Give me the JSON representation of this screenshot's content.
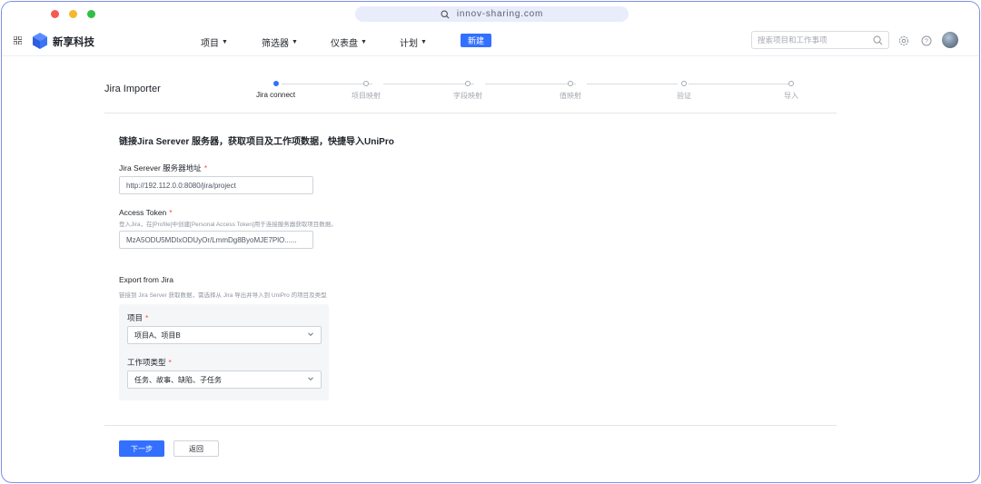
{
  "window": {
    "url": "innov-sharing.com"
  },
  "header": {
    "brand": "新享科技",
    "nav": [
      "项目",
      "筛选器",
      "仪表盘",
      "计划"
    ],
    "new_label": "新建",
    "search_placeholder": "搜索项目和工作事项",
    "accent_color": "#3370ff"
  },
  "page": {
    "title": "Jira Importer",
    "steps": [
      "Jira connect",
      "项目映射",
      "字段映射",
      "值映射",
      "验证",
      "导入"
    ],
    "active_step": 0
  },
  "form": {
    "intro": "链接Jira Serever 服务器，获取项目及工作项数据，快捷导入UniPro",
    "server_label": "Jira Serever 服务器地址",
    "server_value": "http://192.112.0.0:8080/jira/project",
    "token_label": "Access Token",
    "token_hint": "登入Jira，在[Profile]中创建[Personal Access Token]用于连接服务器获取项目数据。",
    "token_value": "MzA5ODU5MDIxODUyOr/LmmDg8ByoMJE7PlO......",
    "required_mark": "*",
    "export_title": "Export from Jira",
    "export_hint": "链接到 Jira Server 获取数据，需选择从 Jira 导出并导入到 UniPro 的项目及类型",
    "project_label": "项目",
    "project_value": "项目A、项目B",
    "type_label": "工作项类型",
    "type_value": "任务、故事、缺陷、子任务"
  },
  "footer": {
    "next_label": "下一步",
    "back_label": "返回"
  }
}
